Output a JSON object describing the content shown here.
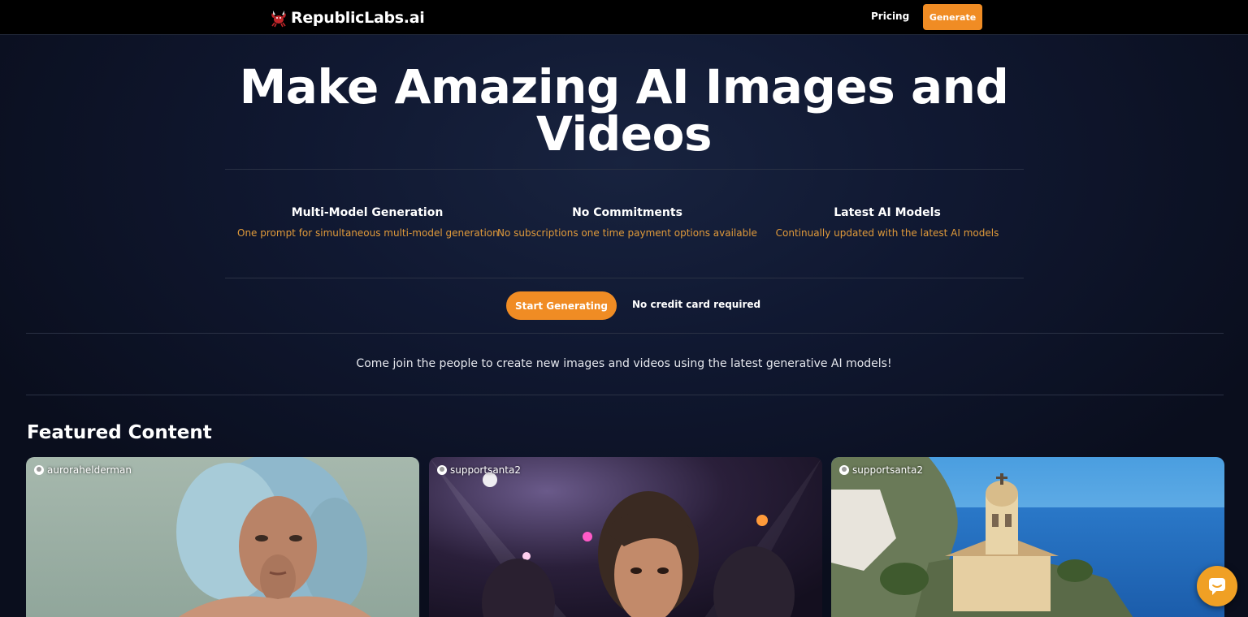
{
  "navbar": {
    "logo_text": "RepublicLabs.ai",
    "pricing_label": "Pricing",
    "generate_label": "Generate"
  },
  "hero": {
    "title": "Make Amazing AI Images and Videos"
  },
  "features": [
    {
      "title": "Multi-Model Generation",
      "description": "One prompt for simultaneous multi-model generation"
    },
    {
      "title": "No Commitments",
      "description": "No subscriptions one time payment options available"
    },
    {
      "title": "Latest AI Models",
      "description": "Continually updated with the latest AI models"
    }
  ],
  "cta": {
    "start_label": "Start Generating",
    "note": "No credit card required"
  },
  "join_text": "Come join the people to create new images and videos using the latest generative AI models!",
  "featured": {
    "heading": "Featured Content",
    "cards": [
      {
        "username": "aurorahelderman"
      },
      {
        "username": "supportsanta2"
      },
      {
        "username": "supportsanta2"
      }
    ]
  },
  "colors": {
    "accent": "#f08c24",
    "feature_desc": "#e09a3a",
    "background": "#0b0f1f"
  },
  "icons": {
    "logo": "crab-logo-icon",
    "user": "user-avatar-icon",
    "chat": "chat-bubble-icon"
  }
}
